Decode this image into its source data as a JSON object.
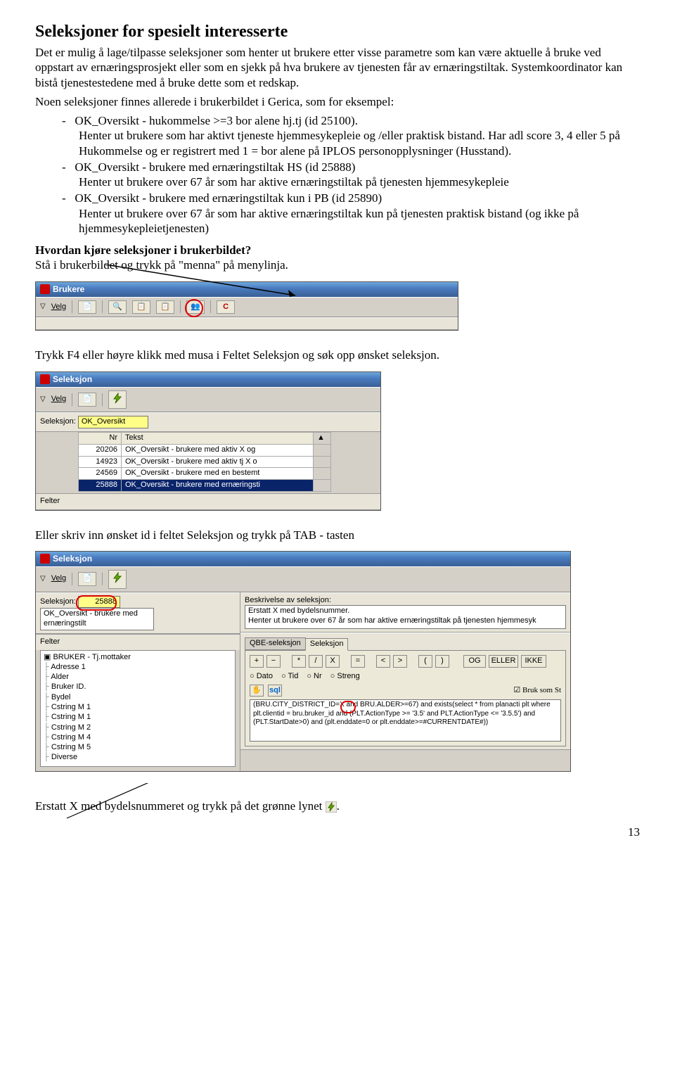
{
  "heading": "Seleksjoner for spesielt interesserte",
  "intro1": "Det er mulig å lage/tilpasse seleksjoner som henter ut brukere etter visse parametre som kan være aktuelle å bruke ved oppstart av ernæringsprosjekt eller som en sjekk på hva brukere av tjenesten får av ernæringstiltak. Systemkoordinator kan bistå tjenestestedene med å bruke dette som et redskap.",
  "intro2": "Noen seleksjoner finnes allerede i brukerbildet i Gerica, som for eksempel:",
  "items": [
    {
      "title": "OK_Oversikt - hukommelse >=3 bor alene hj.tj (id 25100).",
      "desc": "Henter ut brukere som har aktivt tjeneste hjemmesykepleie og /eller praktisk bistand. Har adl score 3, 4 eller 5 på Hukommelse og er registrert med 1 = bor alene på IPLOS personopplysninger (Husstand)."
    },
    {
      "title": "OK_Oversikt - brukere med ernæringstiltak HS (id 25888)",
      "desc": "Henter ut brukere over 67 år som har aktive ernæringstiltak på tjenesten hjemmesykepleie"
    },
    {
      "title": "OK_Oversikt - brukere med ernæringstiltak kun i PB (id 25890)",
      "desc": "Henter ut brukere over 67 år som har aktive ernæringstiltak kun på tjenesten praktisk bistand (og ikke på hjemmesykepleietjenesten)"
    }
  ],
  "how_title": "Hvordan kjøre seleksjoner i brukerbildet?",
  "how_line": "Stå i brukerbildet og trykk på \"menna\" på menylinja.",
  "f4_line": "Trykk F4 eller høyre klikk med musa i Feltet Seleksjon og søk opp ønsket seleksjon.",
  "tab_line": "Eller skriv inn ønsket id i feltet Seleksjon og trykk på TAB - tasten",
  "end_line": "Erstatt X med bydelsnummeret og trykk på det grønne lynet ",
  "page": "13",
  "ss1": {
    "title": "Brukere",
    "velg": "Velg"
  },
  "ss2": {
    "title": "Seleksjon",
    "velg": "Velg",
    "field_label": "Seleksjon:",
    "field_value": "OK_Oversikt",
    "col1": "Nr",
    "col2": "Tekst",
    "rows": [
      {
        "nr": "20206",
        "txt": "OK_Oversikt - brukere med aktiv X og"
      },
      {
        "nr": "14923",
        "txt": "OK_Oversikt - brukere med aktiv tj X o"
      },
      {
        "nr": "24569",
        "txt": "OK_Oversikt - brukere med en bestemt"
      },
      {
        "nr": "25888",
        "txt": "OK_Oversikt - brukere med ernæringsti"
      }
    ],
    "felter_label": "Felter"
  },
  "ss3": {
    "title": "Seleksjon",
    "velg": "Velg",
    "field_label": "Seleksjon:",
    "id_value": "25888",
    "name_value": "OK_Oversikt - brukere med ernæringstilt",
    "desc_label": "Beskrivelse av seleksjon:",
    "desc_text": "Erstatt X med bydelsnummer.\nHenter ut brukere over 67 år som har aktive ernæringstiltak på tjenesten hjemmesyk",
    "felter_label": "Felter",
    "tree": [
      "BRUKER - Tj.mottaker",
      "Adresse 1",
      "Alder",
      "Bruker ID.",
      "Bydel",
      "Cstring M 1",
      "Cstring M 1",
      "Cstring M 2",
      "Cstring M 4",
      "Cstring M 5",
      "Diverse"
    ],
    "tab_qbe": "QBE-seleksjon",
    "tab_sel": "Seleksjon",
    "ops": [
      "+",
      "−",
      "*",
      "/",
      "X",
      "=",
      "<",
      ">",
      "(",
      ")",
      "OG",
      "ELLER",
      "IKKE"
    ],
    "radios": [
      "Dato",
      "Tid",
      "Nr",
      "Streng"
    ],
    "bruk": "Bruk som St",
    "sql": "(BRU.CITY_DISTRICT_ID=X and BRU.ALDER>=67) and exists(select * from planacti plt where plt.clientid = bru.bruker_id and (PLT.ActionType >= '3.5' and PLT.ActionType <= '3.5.5') and (PLT.StartDate>0) and (plt.enddate=0 or plt.enddate>=#CURRENTDATE#))"
  }
}
